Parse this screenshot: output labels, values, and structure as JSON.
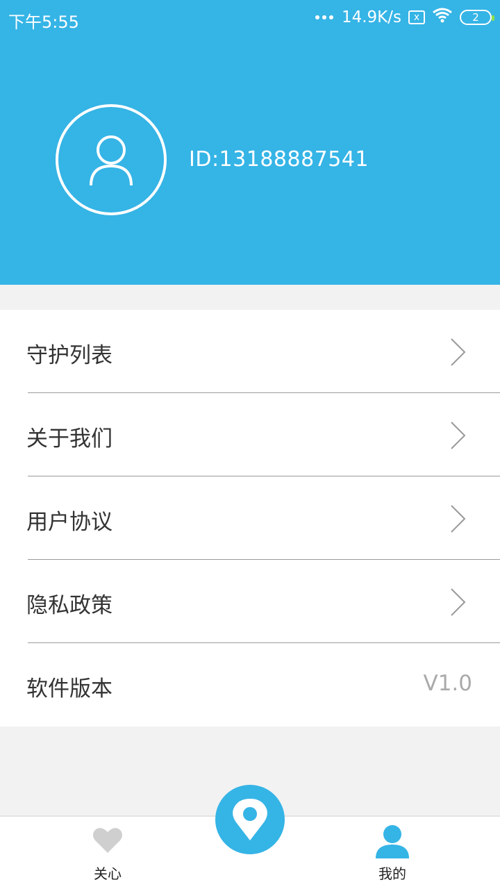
{
  "status_bar": {
    "time": "下午5:55",
    "network_speed": "14.9K/s",
    "sim_icon": "x",
    "battery": "2",
    "wifi_icon": "wifi-icon"
  },
  "profile": {
    "avatar_icon": "user-icon",
    "id_text": "ID:13188887541"
  },
  "menu": {
    "items": [
      {
        "label": "守护列表",
        "icon": "chevron-right-icon"
      },
      {
        "label": "关于我们",
        "icon": "chevron-right-icon"
      },
      {
        "label": "用户协议",
        "icon": "chevron-right-icon"
      },
      {
        "label": "隐私政策",
        "icon": "chevron-right-icon"
      },
      {
        "label": "软件版本",
        "value": "V1.0"
      }
    ]
  },
  "bottom_nav": {
    "tabs": [
      {
        "label": "关心",
        "icon": "heart-icon"
      },
      {
        "label": "",
        "icon": "location-pin-icon"
      },
      {
        "label": "我的",
        "icon": "person-icon"
      }
    ]
  },
  "colors": {
    "accent": "#35b4e6",
    "background": "#f2f2f2",
    "inactive_icon": "#cfcfcf"
  }
}
